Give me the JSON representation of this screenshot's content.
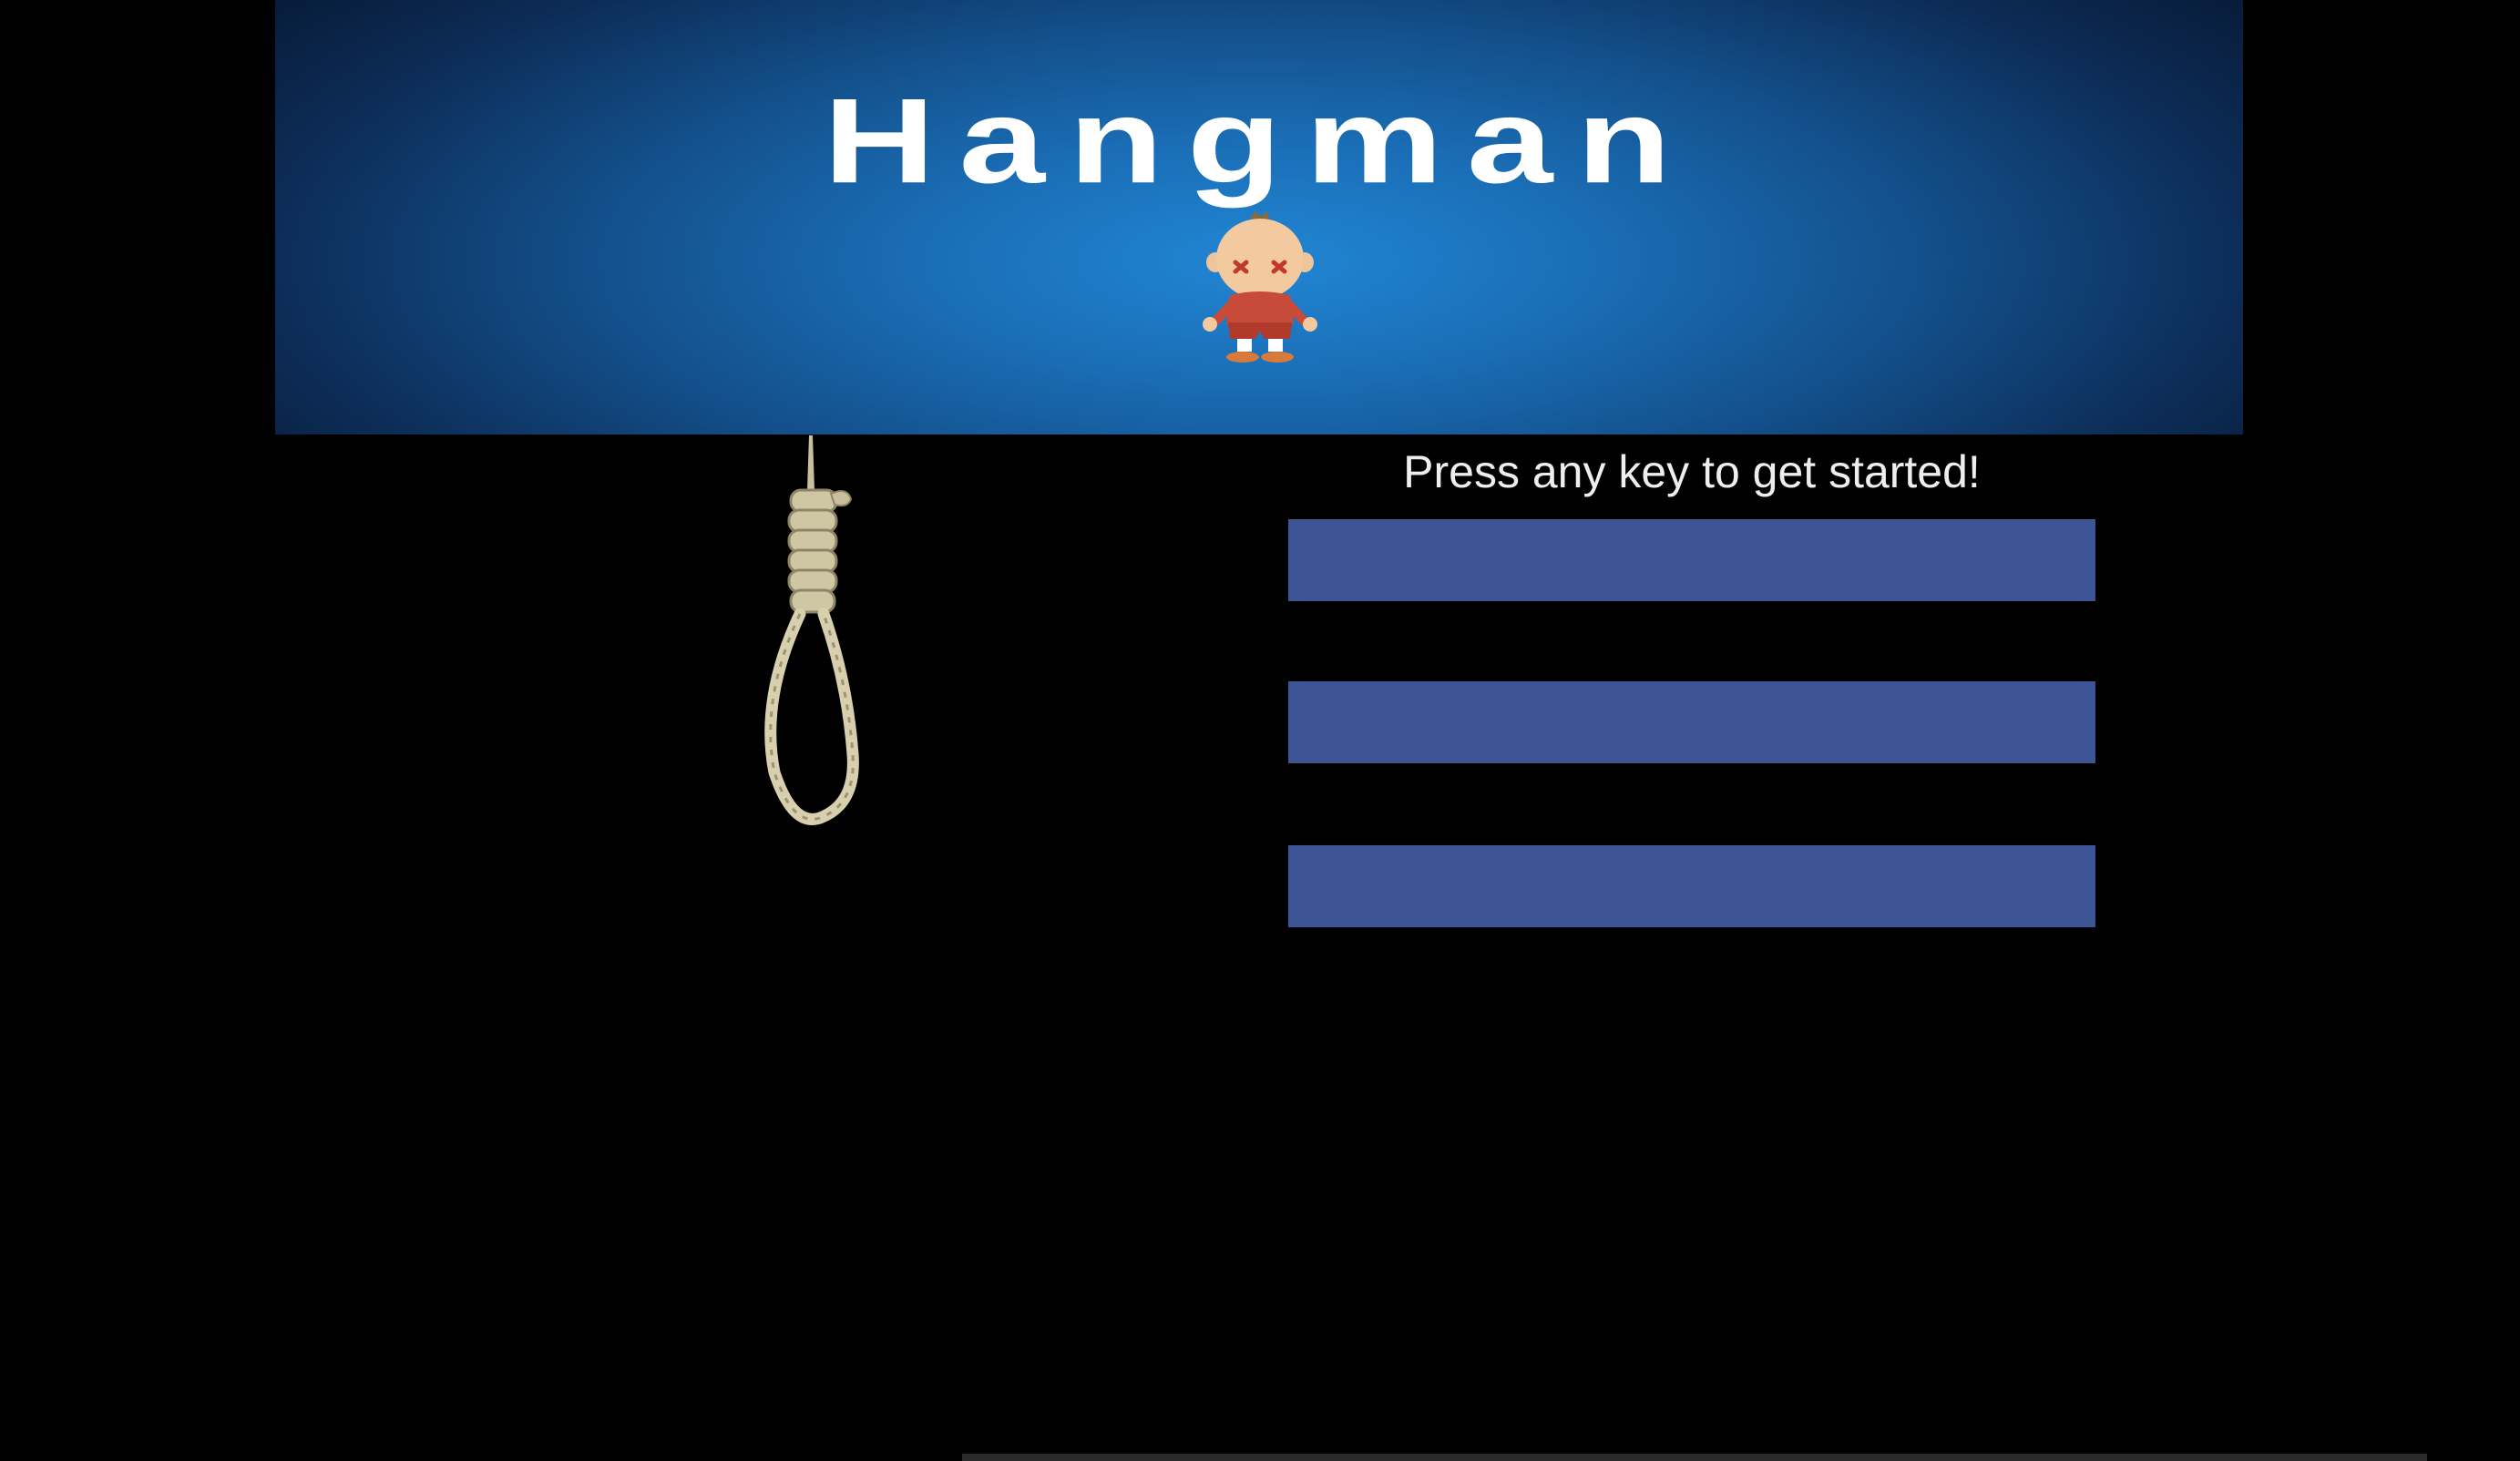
{
  "banner": {
    "title": "Hangman",
    "background_colors": [
      "#2186d4",
      "#134f8a",
      "#081c3a"
    ]
  },
  "game": {
    "prompt": "Press any key to get started!",
    "panel_color": "#3c5494",
    "word_display": "",
    "guessed_letters": "",
    "guesses_remaining": ""
  },
  "icons": {
    "mascot": "hangman-character-icon",
    "noose": "noose-icon"
  }
}
